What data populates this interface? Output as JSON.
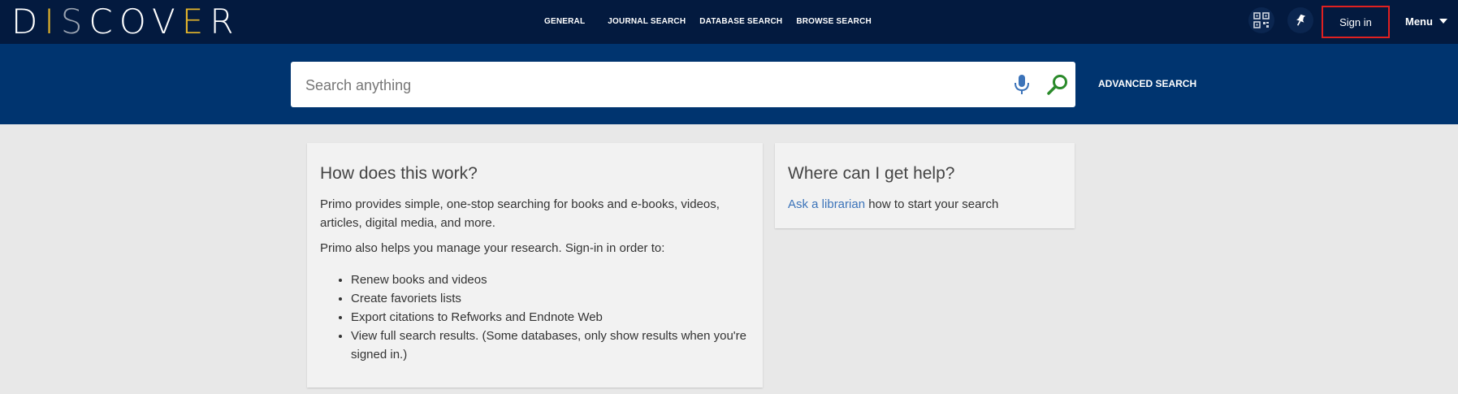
{
  "header": {
    "logo": {
      "part1": "D",
      "part2": "I",
      "part3": "S",
      "part4": "COV",
      "part5": "E",
      "part6": "R"
    },
    "nav": [
      "GENERAL",
      "JOURNAL SEARCH",
      "DATABASE SEARCH",
      "BROWSE SEARCH"
    ],
    "sign_in": "Sign in",
    "menu": "Menu",
    "icons": [
      "qr-code-icon",
      "pin-icon"
    ]
  },
  "search": {
    "placeholder": "Search anything",
    "advanced": "ADVANCED SEARCH",
    "icons": [
      "microphone-icon",
      "search-icon"
    ]
  },
  "info_card": {
    "title": "How does this work?",
    "para1": "Primo provides simple, one-stop searching for books and e-books, videos, articles, digital media, and more.",
    "para2": "Primo also helps you manage your research. Sign-in in order to:",
    "items": [
      "Renew books and videos",
      "Create favoriets lists",
      "Export citations to Refworks and Endnote Web",
      "View full search results. (Some databases, only show results when you're signed in.)"
    ]
  },
  "help_card": {
    "title": "Where can I get help?",
    "link": "Ask a librarian",
    "text": " how to start your search"
  },
  "colors": {
    "topbar": "#031a3f",
    "searchband": "#00346f",
    "accent_gold": "#e5b62b",
    "link": "#3b73b9",
    "highlight_border": "#e02020"
  }
}
